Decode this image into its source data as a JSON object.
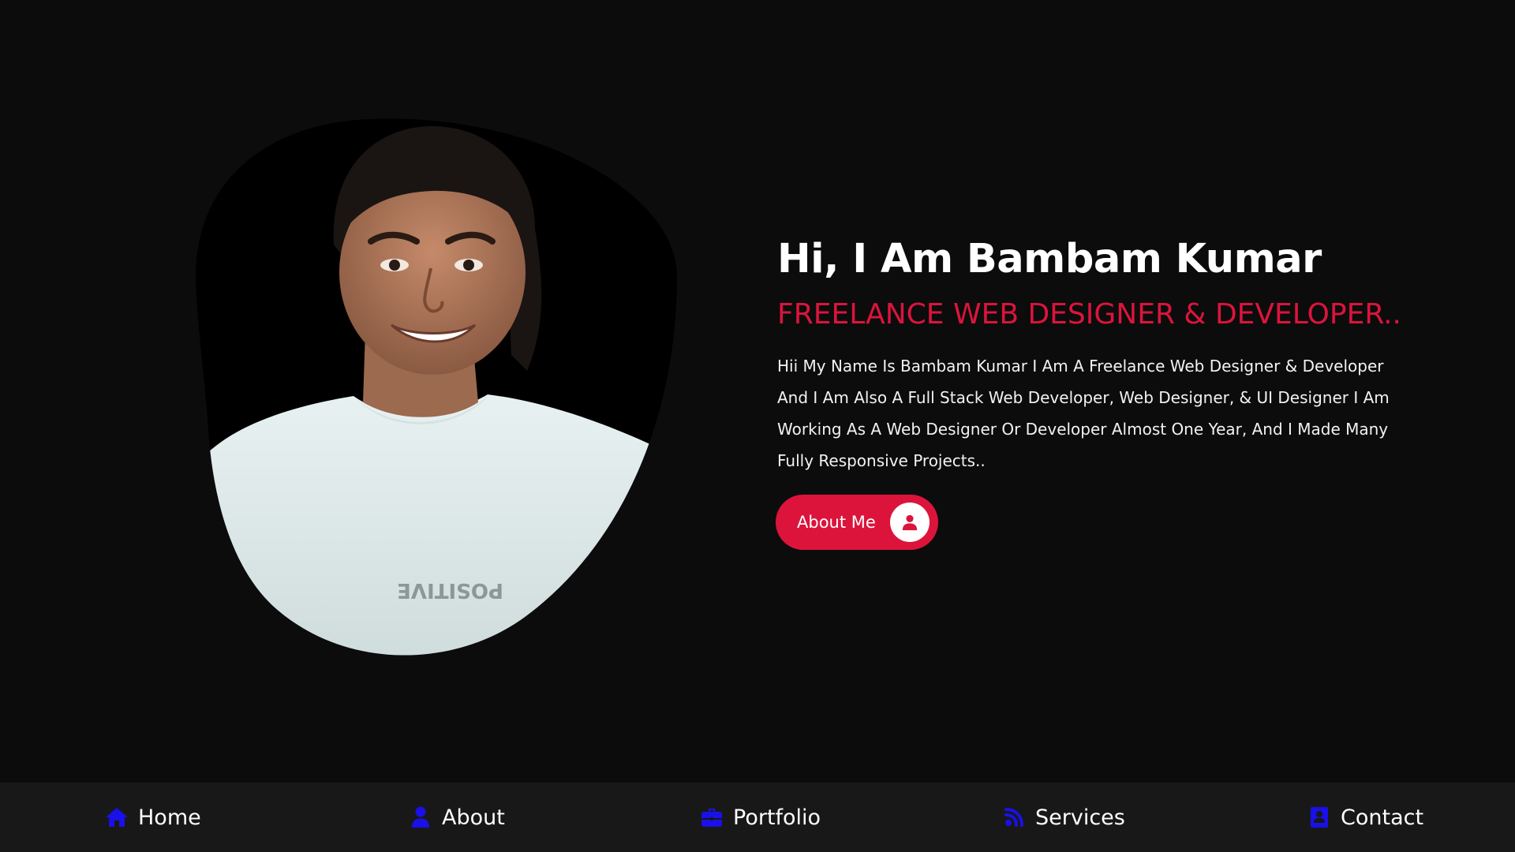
{
  "hero": {
    "title": "Hi, I Am Bambam Kumar",
    "subtitle": "FREELANCE WEB DESIGNER & DEVELOPER..",
    "description": "Hii My Name Is Bambam Kumar I Am A Freelance Web Designer & Developer And I Am Also A Full Stack Web Developer, Web Designer, & UI Designer I Am Working As A Web Designer Or Developer Almost One Year, And I Made Many Fully Responsive Projects..",
    "button_label": "About Me",
    "button_icon": "user-icon",
    "image": "profile-photo"
  },
  "nav": {
    "items": [
      {
        "label": "Home",
        "icon": "home-icon"
      },
      {
        "label": "About",
        "icon": "user-icon"
      },
      {
        "label": "Portfolio",
        "icon": "briefcase-icon"
      },
      {
        "label": "Services",
        "icon": "services-icon"
      },
      {
        "label": "Contact",
        "icon": "contact-book-icon"
      }
    ]
  },
  "colors": {
    "background": "#0c0c0c",
    "accent": "#dc143c",
    "nav_background": "#181818",
    "nav_icon": "#1a10e8",
    "text": "#ffffff"
  }
}
